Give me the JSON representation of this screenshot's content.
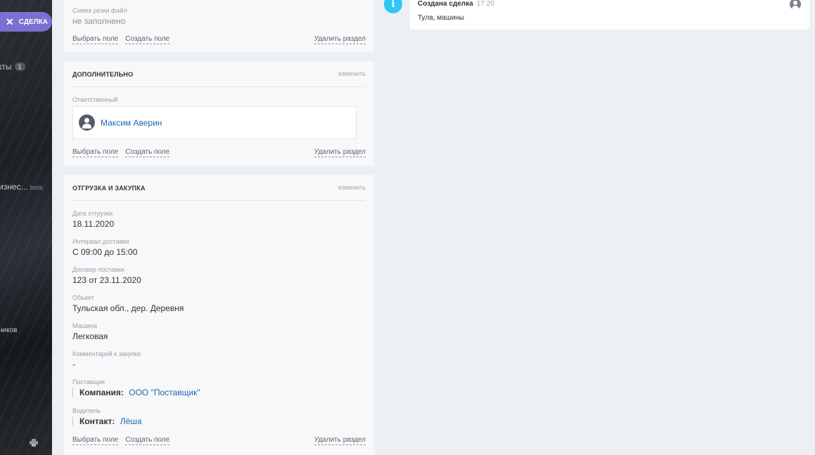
{
  "sidebar": {
    "deal_label": "СДЕЛКА",
    "close_glyph": "✕",
    "item_partial_1": "кты",
    "item_partial_1_count": "1",
    "item_partial_2": "изнес...",
    "item_partial_2_badge": "beta",
    "item_partial_3": "ников"
  },
  "card_top": {
    "field_label": "Схема резки файл",
    "field_value": "не заполнено",
    "select_field": "Выбрать поле",
    "create_field": "Создать поле",
    "delete_section": "Удалить раздел"
  },
  "card_extra": {
    "title": "ДОПОЛНИТЕЛЬНО",
    "change": "изменить",
    "responsible_label": "Ответственный",
    "responsible_name": "Максим Аверин",
    "select_field": "Выбрать поле",
    "create_field": "Создать поле",
    "delete_section": "Удалить раздел"
  },
  "card_ship": {
    "title": "ОТГРУЗКА И ЗАКУПКА",
    "change": "изменить",
    "fields": [
      {
        "label": "Дата отгрузки",
        "value": "18.11.2020"
      },
      {
        "label": "Интервал доставки",
        "value": "С 09:00 до 15:00"
      },
      {
        "label": "Договор поставки",
        "value": "123 от 23.11.2020"
      },
      {
        "label": "Объект",
        "value": "Тульская обл., дер. Деревня"
      },
      {
        "label": "Машина",
        "value": "Легковая"
      },
      {
        "label": "Комментарий к закупке",
        "value": "-"
      }
    ],
    "supplier_label": "Поставщик",
    "supplier_type": "Компания:",
    "supplier_name": "ООО \"Поставщик\"",
    "driver_label": "Водитель",
    "driver_type": "Контакт:",
    "driver_name": "Лёша",
    "select_field": "Выбрать поле",
    "create_field": "Создать поле",
    "delete_section": "Удалить раздел"
  },
  "timeline": {
    "icon_glyph": "i",
    "title": "Создана сделка",
    "time": "17:20",
    "text": "Тула, машины"
  },
  "colors": {
    "accent": "#7b6fd0",
    "info": "#2fc6f6",
    "link": "#2067b0"
  }
}
